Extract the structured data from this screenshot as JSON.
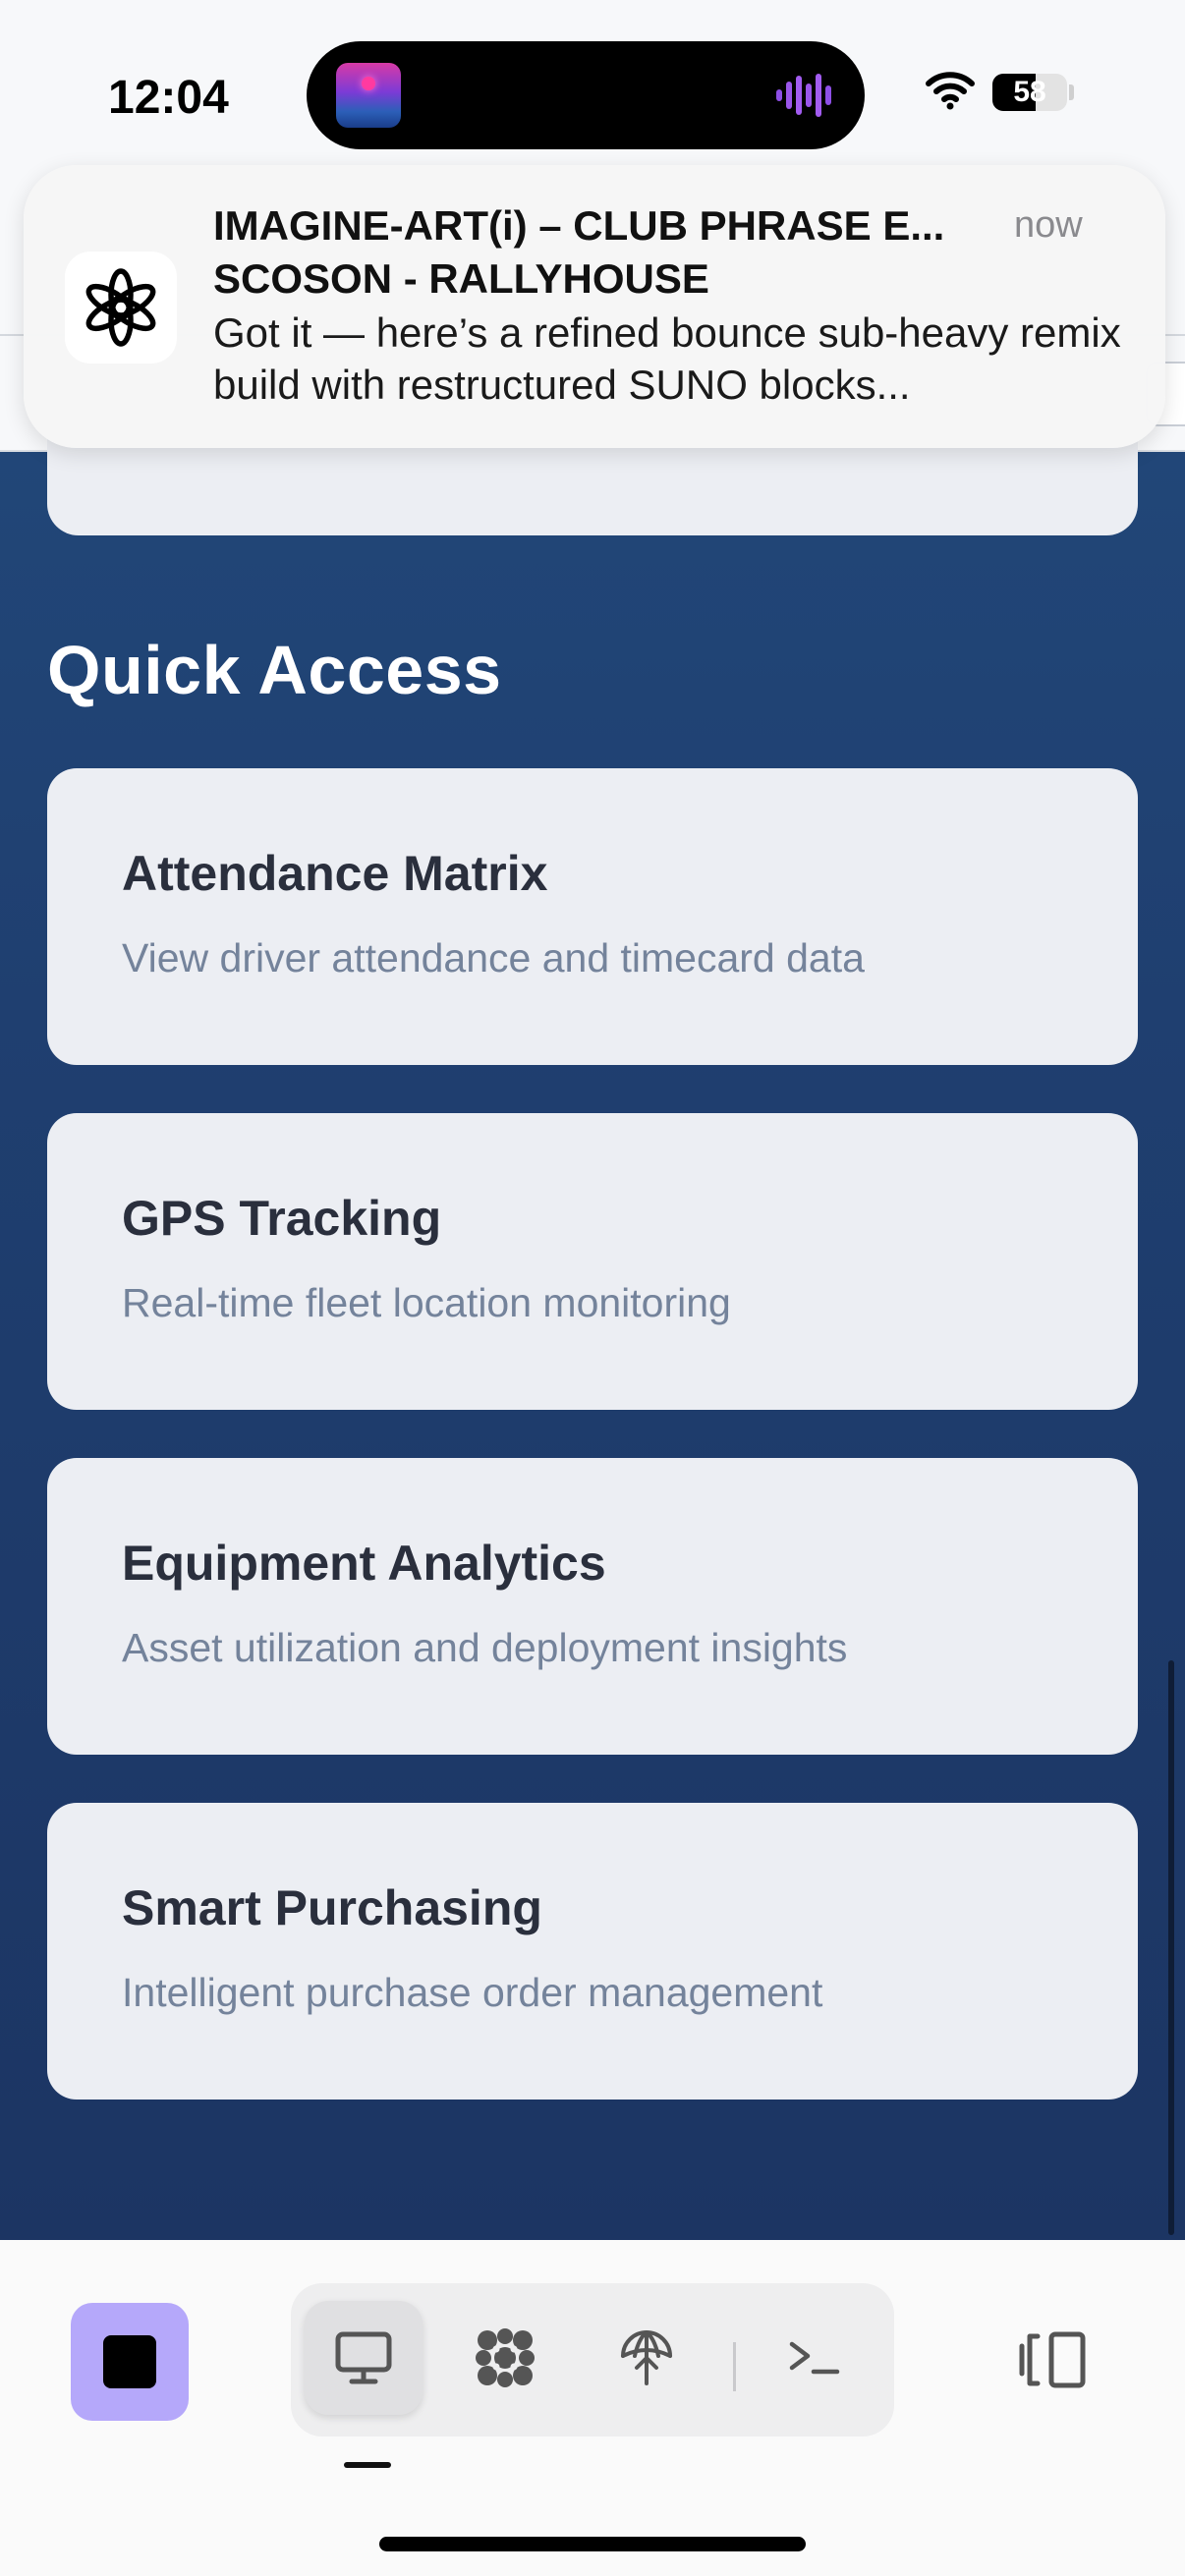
{
  "status_bar": {
    "time": "12:04",
    "battery_level": "58",
    "battery_fraction": 0.58,
    "icons": [
      "now-playing-artwork-icon",
      "audio-waveform-icon",
      "wifi-icon",
      "battery-icon"
    ],
    "waveform_color": "#a25cf0"
  },
  "notification": {
    "app_icon": "chatgpt-logo-icon",
    "title": "IMAGINE-ART(i) – CLUB PHRASE E...",
    "subtitle": "SCOSON - RALLYHOUSE",
    "body": "Got it — here’s a refined bounce sub-heavy remix build with restructured SUNO blocks...",
    "time": "now"
  },
  "main": {
    "section_title": "Quick Access",
    "cards": [
      {
        "title": "Attendance Matrix",
        "description": "View driver attendance and timecard data"
      },
      {
        "title": "GPS Tracking",
        "description": "Real-time fleet location monitoring"
      },
      {
        "title": "Equipment Analytics",
        "description": "Asset utilization and deployment insights"
      },
      {
        "title": "Smart Purchasing",
        "description": "Intelligent purchase order management"
      }
    ],
    "colors": {
      "background": "#1f3f70",
      "card": "#eceef3",
      "card_title": "#2a2f3d",
      "card_description": "#74839b"
    }
  },
  "toolbar": {
    "stop_button_color": "#b5a8fa",
    "tools": [
      "desktop-icon",
      "flower-pattern-icon",
      "network-upload-icon",
      "terminal-prompt-icon"
    ],
    "active_tool": "desktop-icon",
    "side_button_icon": "tab-switcher-icon"
  }
}
